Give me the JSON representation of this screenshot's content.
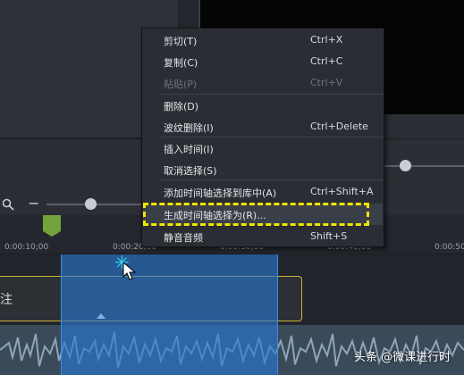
{
  "context_menu": {
    "items": [
      {
        "label": "剪切(T)",
        "shortcut": "Ctrl+X",
        "enabled": true
      },
      {
        "label": "复制(C)",
        "shortcut": "Ctrl+C",
        "enabled": true
      },
      {
        "label": "粘贴(P)",
        "shortcut": "Ctrl+V",
        "enabled": false
      },
      {
        "label": "删除(D)",
        "shortcut": "",
        "enabled": true
      },
      {
        "label": "波纹删除(I)",
        "shortcut": "Ctrl+Delete",
        "enabled": true
      },
      {
        "label": "插入时间(I)",
        "shortcut": "",
        "enabled": true
      },
      {
        "label": "取消选择(S)",
        "shortcut": "",
        "enabled": true
      },
      {
        "label": "添加时间轴选择到库中(A)",
        "shortcut": "Ctrl+Shift+A",
        "enabled": true
      },
      {
        "label": "生成时间轴选择为(R)...",
        "shortcut": "",
        "enabled": true,
        "highlighted": true
      },
      {
        "label": "静音音频",
        "shortcut": "Shift+S",
        "enabled": true
      }
    ]
  },
  "timeline": {
    "ticks": [
      "0:00:10;00",
      "0:00:20;00",
      "0:00:30;00",
      "0:00:40;00",
      "0:00:50"
    ],
    "annotation_label": "注"
  },
  "icons": {
    "zoom": "search-icon",
    "zoom_out": "minus-icon",
    "playhead": "playhead-marker",
    "cursor": "mouse-pointer-icon",
    "sparkle": "click-sparkle-icon"
  },
  "colors": {
    "selection": "#2878d2",
    "playhead": "#73a33a",
    "annotation_border": "#d1b23c",
    "highlight_box": "#f2e400"
  },
  "watermark": {
    "text": "头条 @微课进行时"
  }
}
